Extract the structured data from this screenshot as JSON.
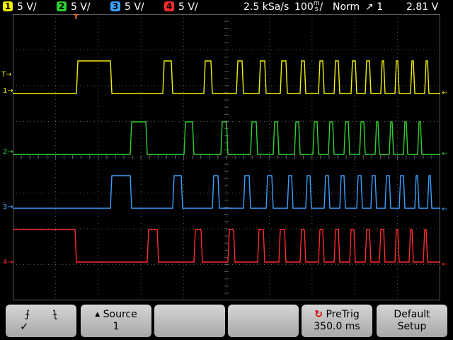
{
  "topbar": {
    "channels": [
      {
        "num": "1",
        "scale": "5 V/",
        "color": "#f3f000"
      },
      {
        "num": "2",
        "scale": "5 V/",
        "color": "#2fd12f"
      },
      {
        "num": "3",
        "scale": "5 V/",
        "color": "#3aa0ff"
      },
      {
        "num": "4",
        "scale": "5 V/",
        "color": "#ff2a2a"
      }
    ],
    "sample_rate": "2.5 kSa/s",
    "timebase": "100",
    "timebase_unit": "m",
    "timebase_unit2": "s",
    "timebase_suffix": "/",
    "trigger_mode": "Norm",
    "trigger_symbol": "↗",
    "trigger_source": "1",
    "trigger_level": "2.81 V"
  },
  "softkeys": {
    "slope": {
      "rise": "⨍",
      "fall": "⨍",
      "check": "✓"
    },
    "source": {
      "label": "Source",
      "value": "1",
      "arrow": "▲"
    },
    "pretrig": {
      "label": "PreTrig",
      "value": "350.0 ms"
    },
    "default": {
      "label1": "Default",
      "label2": "Setup"
    }
  },
  "markers": {
    "trigger_pos": "T",
    "ch_labels": [
      "1",
      "2",
      "3",
      "4"
    ],
    "trig_level_marker": "T"
  },
  "colors": {
    "ch1": "#f3f000",
    "ch2": "#2fd12f",
    "ch3": "#3aa0ff",
    "ch4": "#ff2a2a",
    "grid": "#5a5a5a",
    "trigger_marker": "#ff7a1a"
  }
}
